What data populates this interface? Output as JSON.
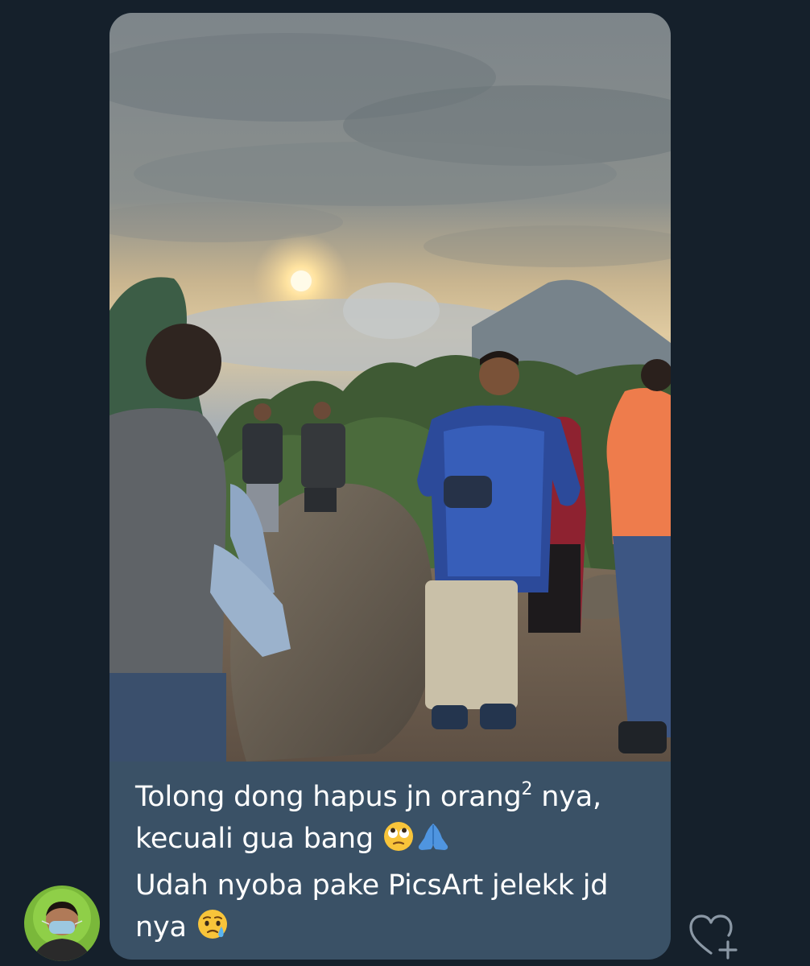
{
  "message": {
    "caption_line1_before_sup": "Tolong dong hapus jn orang",
    "caption_line1_sup": "2",
    "caption_line1_after_sup": " nya,",
    "caption_line2": "kecuali gua bang ",
    "caption_line3": "Udah nyoba pake PicsArt jelekk jd",
    "caption_line4": "nya ",
    "emojis": [
      "face-with-rolling-eyes",
      "folded-hands",
      "crying-face"
    ]
  },
  "colors": {
    "background": "#15202b",
    "bubble": "#3a5166",
    "text": "#ffffff",
    "icon": "#8b98a5"
  },
  "icons": {
    "avatar": "user-avatar",
    "react": "heart-plus-icon"
  }
}
